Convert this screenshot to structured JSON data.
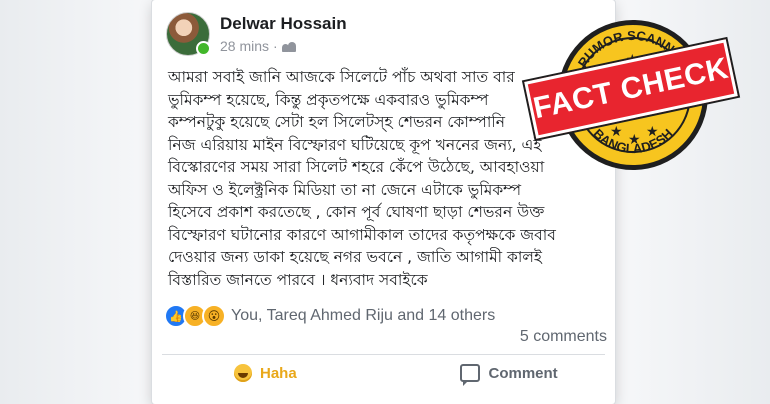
{
  "post": {
    "author": "Delwar Hossain",
    "time": "28 mins",
    "separator": "·",
    "body_lines": [
      "আমরা সবাই জানি আজকে সিলেটে পাঁচ অথবা সাত বার",
      "ভুমিকম্প হয়েছে, কিন্তু প্রকৃতপক্ষে একবারও ভুমিকম্প",
      "কম্পনটুকু হয়েছে সেটা হল সিলেটস্হ শেভরন কোম্পানি",
      "নিজ এরিয়ায় মাইন বিস্ফোরণ ঘটিয়েছে কূপ খননের জন্য, এই",
      "বিস্কোরণের সময় সারা সিলেট শহরে কেঁপে উঠেছে, আবহাওয়া",
      "অফিস ও ইলেক্ট্রনিক মিডিয়া তা না জেনে এটাকে ভুমিকম্প",
      "হিসেবে প্রকাশ করতেছে , কোন পূর্ব ঘোষণা ছাড়া শেভরন উক্ত",
      "বিস্ফোরণ ঘটানোর কারণে আগামীকাল তাদের কতৃপক্ষকে জবাব",
      "দেওয়ার জন্য ডাকা হয়েছে নগর ভবনে , জাতি আগামী কালই",
      "বিস্তারিত জানতে পারবে । ধন্যবাদ সবাইকে"
    ],
    "reactions_text": "You, Tareq Ahmed Riju and 14 others",
    "comments_count": "5 comments",
    "actions": {
      "haha_label": "Haha",
      "comment_label": "Comment"
    }
  },
  "stamp": {
    "top_text": "RUMOR SCANNER",
    "ribbon_text": "FACT CHECK",
    "bottom_text": "BANGLADESH",
    "colors": {
      "ribbon": "#e8252f",
      "circle": "#f7c51f",
      "ink": "#1f1f1f"
    }
  }
}
